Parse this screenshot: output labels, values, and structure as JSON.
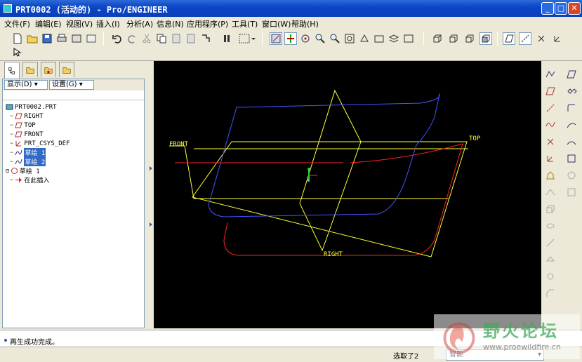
{
  "window": {
    "title": "PRT0002 (活动的) - Pro/ENGINEER"
  },
  "menu": [
    {
      "label": "文件(F)"
    },
    {
      "label": "编辑(E)"
    },
    {
      "label": "视图(V)"
    },
    {
      "label": "插入(I)"
    },
    {
      "label": "分析(A)"
    },
    {
      "label": "信息(N)"
    },
    {
      "label": "应用程序(P)"
    },
    {
      "label": "工具(T)"
    },
    {
      "label": "窗口(W)"
    },
    {
      "label": "帮助(H)"
    }
  ],
  "navigator": {
    "show_label": "显示(D)",
    "settings_label": "设置(G)",
    "tree": [
      {
        "label": "PRT0002.PRT",
        "icon": "part-icon",
        "selected": false
      },
      {
        "label": "RIGHT",
        "icon": "datum-plane-icon",
        "selected": false
      },
      {
        "label": "TOP",
        "icon": "datum-plane-icon",
        "selected": false
      },
      {
        "label": "FRONT",
        "icon": "datum-plane-icon",
        "selected": false
      },
      {
        "label": "PRT_CSYS_DEF",
        "icon": "coordinate-system-icon",
        "selected": false
      },
      {
        "label": "草绘 1",
        "icon": "sketch-icon",
        "selected": true
      },
      {
        "label": "草绘 2",
        "icon": "sketch-icon",
        "selected": true
      },
      {
        "label": "草绘 1",
        "icon": "sketch-icon",
        "selected": false
      },
      {
        "label": "在此插入",
        "icon": "insert-here-icon",
        "selected": false
      }
    ]
  },
  "viewport": {
    "background": "#000000",
    "datum_color": "#ffff33",
    "sketch1_color": "#4455ff",
    "sketch2_color": "#ff2222",
    "labels": {
      "front": "FRONT",
      "top": "TOP",
      "right": "RIGHT"
    }
  },
  "message": {
    "text": "再生成功完成。"
  },
  "status": {
    "selection": "选取了2",
    "filter": "智能"
  },
  "watermark": {
    "title": "野火论坛",
    "url": "www.proewildfire.cn"
  }
}
